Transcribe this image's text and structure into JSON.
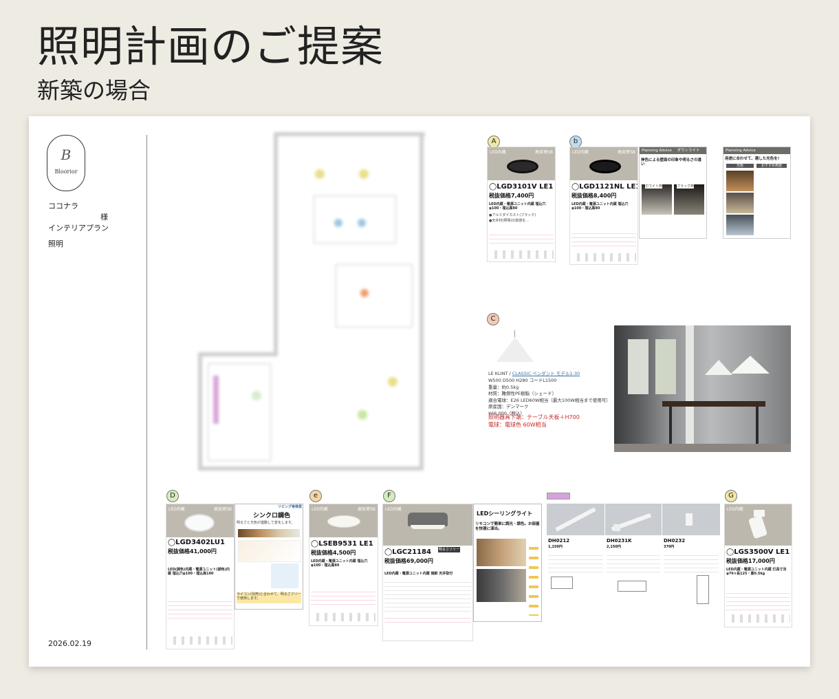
{
  "header": {
    "title": "照明計画のご提案",
    "subtitle": "新築の場合"
  },
  "sidebar": {
    "logo_mark": "B",
    "logo_text": "Bloorior",
    "client_name": "ココナラ",
    "honorific": "様",
    "plan_type": "インテリアプラン",
    "category": "照明",
    "date": "2026.02.19"
  },
  "colors": {
    "background": "#eeebe3",
    "sheet": "#ffffff",
    "badge_green": "#7cb342",
    "badge_orange": "#e6a100",
    "badge_blue": "#5b9bd5",
    "badge_red": "#e57373",
    "accent_red": "#c62828"
  },
  "products": {
    "A": {
      "badge": "A",
      "category": "LED内蔵",
      "grade": "高気密SB",
      "model": "◯LGD3101V LE1",
      "price": "税抜価格7,400円",
      "description": "LED内蔵・電源ユニット内蔵 埋込穴φ100・埋込高80",
      "notes": [
        "●アルミダイカスト(ブラック)",
        "●天井材(照明)の質感を..."
      ]
    },
    "b": {
      "badge": "b",
      "category": "LED内蔵",
      "grade": "高気密SB",
      "model": "◯LGD1121NL LE1",
      "price": "税抜価格8,400円",
      "description": "LED内蔵・電源ユニット内蔵 埋込穴φ100・埋込高80"
    },
    "C": {
      "badge": "C",
      "product_line": "LE KLINT /",
      "product_name": "CLASSIC ペンダント モデル1-30",
      "lines": [
        "W500 D500 H280 コードL1500",
        "重量：約0.5kg",
        "材質：難燃性PE樹脂（シェード）",
        "適合電球：E26 LED60W相当（最大100W相当まで使用可）",
        "原産国：デンマーク",
        "¥66,000（税込）"
      ],
      "red_lines": [
        "照明器具下端：テーブル天板＋H700",
        "電球：電球色 60W相当"
      ]
    },
    "D": {
      "badge": "D",
      "category": "LED内蔵",
      "grade": "高気密SB",
      "model": "◯LGD3402LU1",
      "price": "税抜価格41,000円",
      "description": "LED(調色)内蔵・電源ユニット(調色)内蔵 埋込穴φ100・埋込高100"
    },
    "synchro": {
      "title": "シンクロ調色",
      "badge_text": "リビング等推奨",
      "caption": "明るさと光色が連動して変化します。",
      "footer": "ライコン(別売)と合わせて、明るさフリーで使用します。"
    },
    "e": {
      "badge": "e",
      "category": "LED内蔵",
      "grade": "高気密SB",
      "model": "◯LSEB9531 LE1",
      "price": "税抜価格4,500円",
      "description": "LED内蔵・電源ユニット内蔵 埋込穴φ100・埋込高80"
    },
    "F": {
      "badge": "F",
      "category": "LED内蔵",
      "model": "◯LGC21184",
      "price": "税抜価格69,000円",
      "tag": "明るさフリー",
      "description": "LED内蔵・電源ユニット内蔵 傾斜 天井取付"
    },
    "ceiling": {
      "title": "LEDシーリングライト",
      "caption": "リモコンで簡単に調光・調色。お部屋を快適に演出。"
    },
    "rails": [
      {
        "model": "DH0212",
        "price": "1,150円"
      },
      {
        "model": "DH0231K",
        "price": "2,150円"
      },
      {
        "model": "DH0232",
        "price": "370円"
      }
    ],
    "G": {
      "badge": "G",
      "category": "LED内蔵",
      "model": "◯LGS3500V LE1",
      "price": "税抜価格17,000円",
      "description": "LED内蔵・電源ユニット内蔵 灯具寸法φ76×長125・重0.5kg"
    }
  },
  "advice": [
    {
      "head": "Planning Advice",
      "tag": "ダウンライト",
      "title": "神色による壁面の印象や明るさの違い",
      "labels": [
        "ホワイト枠",
        "ブラック枠"
      ]
    },
    {
      "head": "Planning Advice",
      "title": "用途に合わせて、適した光色を!",
      "cols": [
        "光色",
        "おすすめ用途"
      ]
    }
  ]
}
